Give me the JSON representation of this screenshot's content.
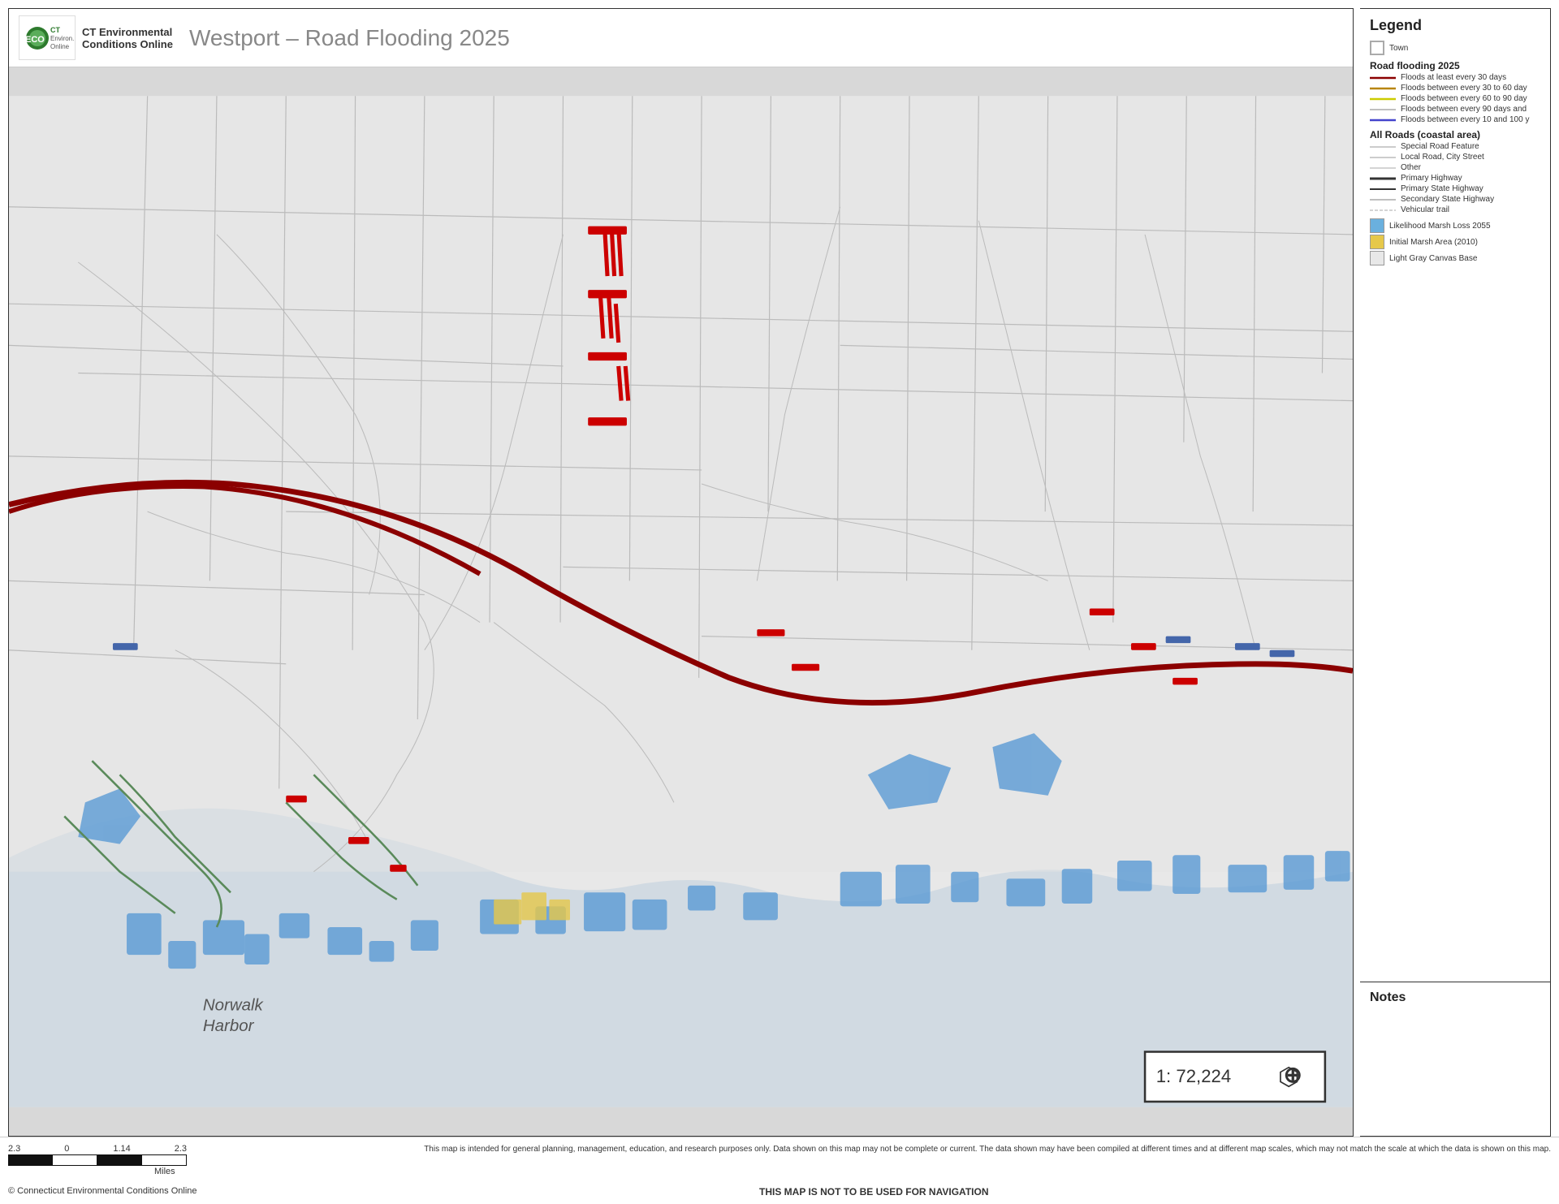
{
  "header": {
    "logo_text1": "CT Environmental",
    "logo_text2": "Conditions Online",
    "logo_abbr": "ECO",
    "map_title": "Westport – Road Flooding 2025"
  },
  "legend": {
    "title": "Legend",
    "town_label": "Town",
    "road_flooding_title": "Road flooding 2025",
    "flood_items": [
      {
        "label": "Floods at least every 30 days",
        "color": "#8b0000",
        "style": "solid",
        "thickness": 2
      },
      {
        "label": "Floods between every 30 to 60 day",
        "color": "#b8860b",
        "style": "solid",
        "thickness": 2
      },
      {
        "label": "Floods between every 60 to 90 day",
        "color": "#cccc00",
        "style": "solid",
        "thickness": 2
      },
      {
        "label": "Floods between every 90 days and",
        "color": "#aaa",
        "style": "solid",
        "thickness": 1
      },
      {
        "label": "Floods between every 10 and 100 y",
        "color": "#4444cc",
        "style": "solid",
        "thickness": 2
      }
    ],
    "all_roads_title": "All Roads (coastal area)",
    "road_items": [
      {
        "label": "Special Road Feature",
        "color": "#999",
        "style": "solid",
        "thickness": 1
      },
      {
        "label": "Local Road, City Street",
        "color": "#999",
        "style": "solid",
        "thickness": 1
      },
      {
        "label": "Other",
        "color": "#aaa",
        "style": "solid",
        "thickness": 1
      },
      {
        "label": "Primary Highway",
        "color": "#333",
        "style": "solid",
        "thickness": 3
      },
      {
        "label": "Primary State Highway",
        "color": "#333",
        "style": "solid",
        "thickness": 2
      },
      {
        "label": "Secondary State Highway",
        "color": "#aaa",
        "style": "solid",
        "thickness": 1
      },
      {
        "label": "Vehicular trail",
        "color": "#aaa",
        "style": "dashed",
        "thickness": 1
      }
    ],
    "marsh_loss_label": "Likelihood Marsh Loss 2055",
    "marsh_loss_color": "#6ab0de",
    "marsh_area_label": "Initial Marsh Area (2010)",
    "marsh_area_color": "#e6c84a",
    "base_label": "Light Gray Canvas Base"
  },
  "notes": {
    "title": "Notes"
  },
  "map": {
    "scale": "1: 72,224",
    "north_arrow": "⬆"
  },
  "bottom": {
    "scale_numbers": [
      "2.3",
      "0",
      "1.14",
      "2.3"
    ],
    "scale_unit": "Miles",
    "disclaimer": "This map is intended for general planning, management, education, and research purposes only. Data shown on this map may not be complete or current. The data shown may have been compiled at different times and at different map scales, which may not match the scale at which the data is shown on this map.",
    "copyright": "© Connecticut Environmental Conditions Online",
    "nav_warning": "THIS MAP IS NOT TO BE USED FOR NAVIGATION"
  }
}
